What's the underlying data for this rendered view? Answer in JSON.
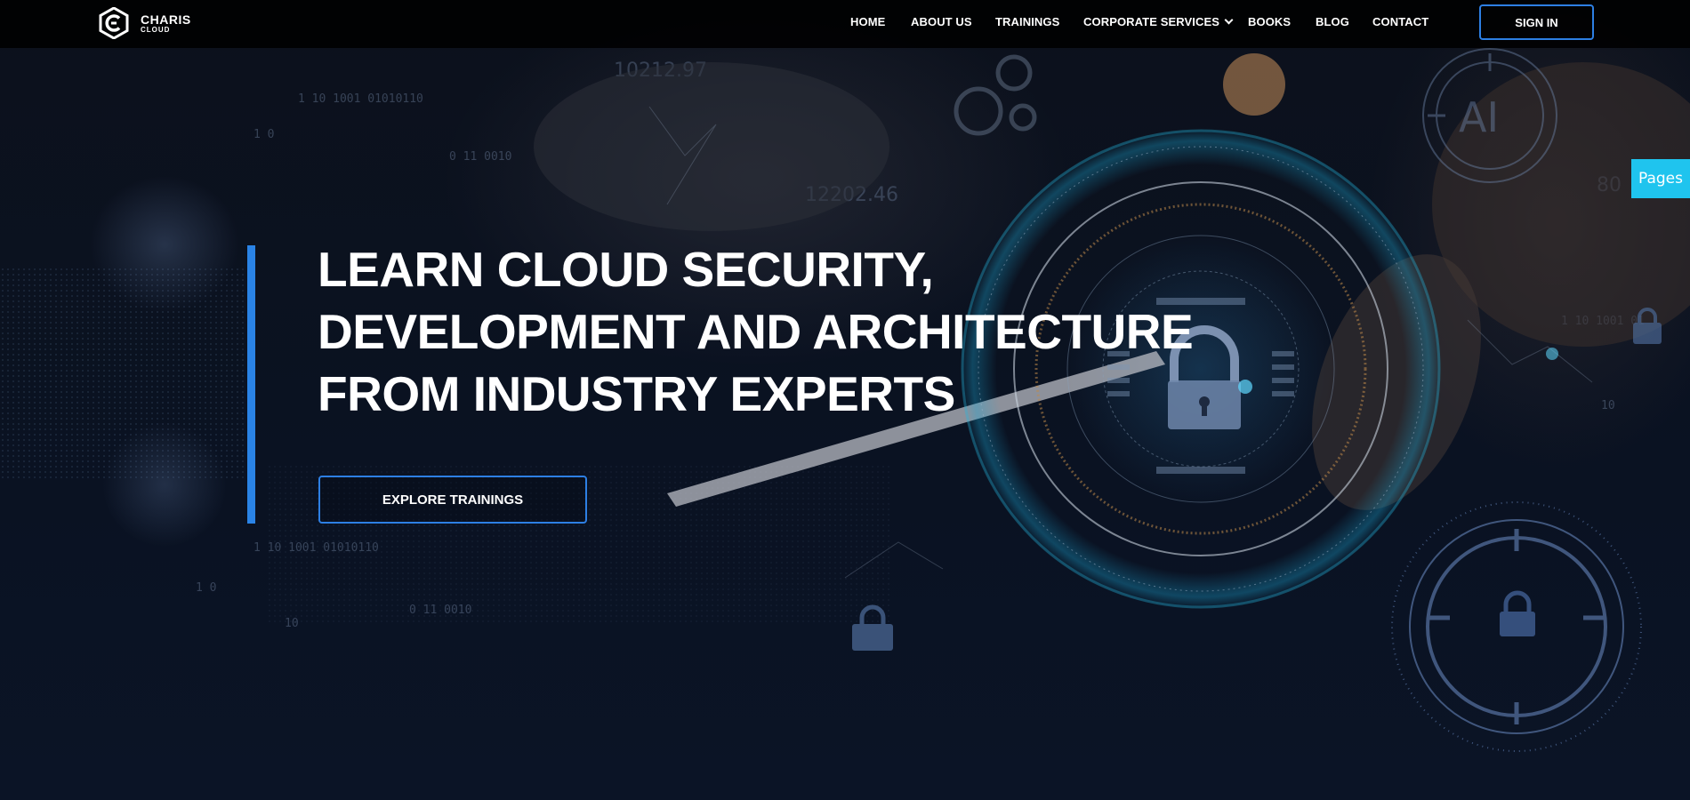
{
  "brand": {
    "name": "CHARIS",
    "sub": "CLOUD"
  },
  "nav": {
    "items": [
      {
        "label": "HOME"
      },
      {
        "label": "ABOUT US"
      },
      {
        "label": "TRAININGS"
      },
      {
        "label": "CORPORATE SERVICES"
      },
      {
        "label": "BOOKS"
      },
      {
        "label": "BLOG"
      },
      {
        "label": "CONTACT"
      }
    ],
    "signin_label": "SIGN IN"
  },
  "hero": {
    "headline": [
      "LEARN CLOUD SECURITY,",
      "DEVELOPMENT AND ARCHITECTURE",
      "FROM INDUSTRY EXPERTS"
    ],
    "cta_label": "EXPLORE TRAININGS"
  },
  "side_tab": {
    "label": "Pages"
  },
  "icons": {
    "logo": "charis-logo-icon",
    "dropdown": "chevron-down-icon",
    "lock": "padlock-icon"
  },
  "colors": {
    "accent": "#2a83e6",
    "pages_tab": "#1fc4ee",
    "navbar_bg": "#000000"
  }
}
